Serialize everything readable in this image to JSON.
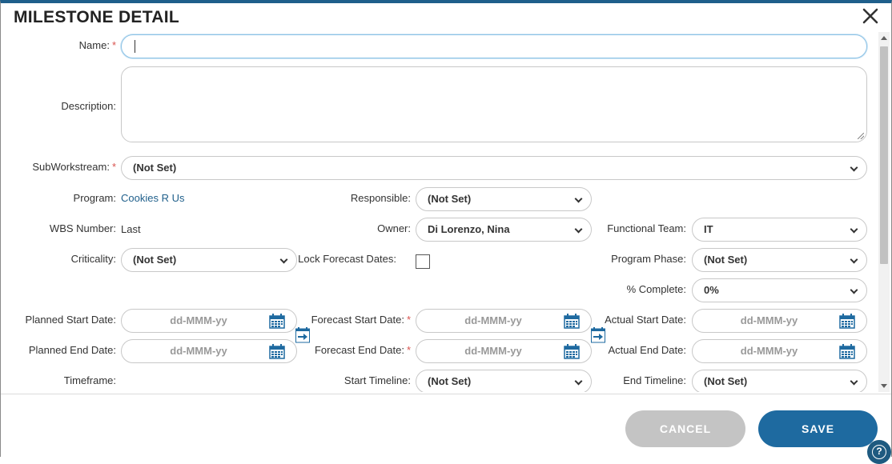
{
  "dialog": {
    "title": "MILESTONE DETAIL",
    "close_icon": "close-icon"
  },
  "fields": {
    "name": {
      "label": "Name:",
      "required": "*",
      "value": "",
      "placeholder": ""
    },
    "description": {
      "label": "Description:",
      "value": ""
    },
    "subworkstream": {
      "label": "SubWorkstream:",
      "required": "*",
      "value": "(Not Set)"
    },
    "program": {
      "label": "Program:",
      "value": "Cookies R Us"
    },
    "responsible": {
      "label": "Responsible:",
      "value": "(Not Set)"
    },
    "wbs_number": {
      "label": "WBS Number:",
      "value": "Last"
    },
    "owner": {
      "label": "Owner:",
      "value": "Di Lorenzo, Nina"
    },
    "functional_team": {
      "label": "Functional Team:",
      "value": "IT"
    },
    "criticality": {
      "label": "Criticality:",
      "value": "(Not Set)"
    },
    "lock_forecast_dates": {
      "label": "Lock Forecast Dates:",
      "checked": false
    },
    "program_phase": {
      "label": "Program Phase:",
      "value": "(Not Set)"
    },
    "percent_complete": {
      "label": "% Complete:",
      "value": "0%"
    },
    "planned_start_date": {
      "label": "Planned Start Date:",
      "placeholder": "dd-MMM-yy"
    },
    "forecast_start_date": {
      "label": "Forecast Start Date:",
      "required": "*",
      "placeholder": "dd-MMM-yy"
    },
    "actual_start_date": {
      "label": "Actual Start Date:",
      "placeholder": "dd-MMM-yy"
    },
    "planned_end_date": {
      "label": "Planned End Date:",
      "placeholder": "dd-MMM-yy"
    },
    "forecast_end_date": {
      "label": "Forecast End Date:",
      "required": "*",
      "placeholder": "dd-MMM-yy"
    },
    "actual_end_date": {
      "label": "Actual End Date:",
      "placeholder": "dd-MMM-yy"
    },
    "timeframe": {
      "label": "Timeframe:"
    },
    "start_timeline": {
      "label": "Start Timeline:",
      "value": "(Not Set)"
    },
    "end_timeline": {
      "label": "End Timeline:",
      "value": "(Not Set)"
    }
  },
  "footer": {
    "cancel_label": "CANCEL",
    "save_label": "SAVE",
    "help_label": "?"
  },
  "colors": {
    "accent": "#1e6aa0",
    "header_bar": "#1f5f8b",
    "required": "#d9534f",
    "link": "#1f5f8b",
    "cancel_bg": "#c4c4c4"
  }
}
